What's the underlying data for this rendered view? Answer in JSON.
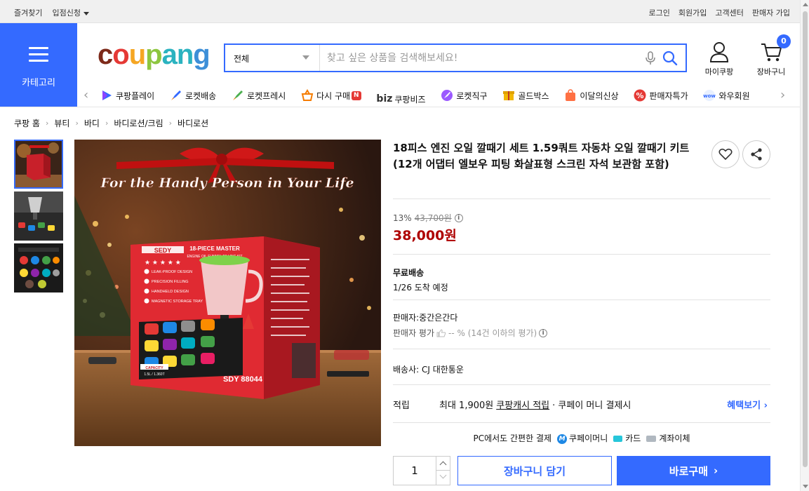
{
  "topbar": {
    "left": [
      "즐겨찾기",
      "입점신청"
    ],
    "right": [
      "로그인",
      "회원가입",
      "고객센터",
      "판매자 가입"
    ]
  },
  "category": {
    "label": "카테고리"
  },
  "logo": {
    "text": [
      "c",
      "o",
      "u",
      "p",
      "a",
      "n",
      "g"
    ]
  },
  "search": {
    "scope": "전체",
    "placeholder": "찾고 싶은 상품을 검색해보세요!"
  },
  "header": {
    "mypage": "마이쿠팡",
    "cart": "장바구니",
    "cart_count": "0"
  },
  "nav": {
    "items": [
      {
        "label": "쿠팡플레이",
        "icon": "play-icon",
        "color": "#346aff"
      },
      {
        "label": "로켓배송",
        "icon": "rocket-icon",
        "color": "#346aff"
      },
      {
        "label": "로켓프레시",
        "icon": "rocket-fresh-icon",
        "color": "#4caf50"
      },
      {
        "label": "다시 구매",
        "icon": "basket-icon",
        "color": "#f57c00",
        "badge": "N"
      },
      {
        "label": "쿠팡비즈",
        "icon": "biz-icon",
        "color": "#333333",
        "prefix": "biz"
      },
      {
        "label": "로켓직구",
        "icon": "rocket-direct-icon",
        "color": "#7e57c2"
      },
      {
        "label": "골드박스",
        "icon": "gold-box-icon",
        "color": "#f2b705"
      },
      {
        "label": "이달의신상",
        "icon": "new-bag-icon",
        "color": "#ff7043"
      },
      {
        "label": "판매자특가",
        "icon": "percent-icon",
        "color": "#e53935"
      },
      {
        "label": "와우회원",
        "icon": "wow-icon",
        "color": "#346aff"
      }
    ]
  },
  "breadcrumb": [
    "쿠팡 홈",
    "뷰티",
    "바디",
    "바디로션/크림",
    "바디로션"
  ],
  "product": {
    "title": "18피스 엔진 오일 깔때기 세트 1.59쿼트 자동차 오일 깔때기 키트 (12개 어댑터 엘보우 피팅 화살표형 스크린 자석 보관함 포함)",
    "discount": "13%",
    "original_price": "43,700원",
    "price": "38,000원",
    "shipping_title": "무료배송",
    "delivery": "1/26 도착 예정",
    "seller": "판매자:중간은간다",
    "seller_rating_label": "판매자 평가",
    "seller_rating_value": "-- % (14건 이하의 평가)",
    "carrier": "배송사: CJ 대한통운",
    "reward_label": "적립",
    "reward_text": "최대 1,900원",
    "reward_link": "쿠팡캐시 적립",
    "reward_tail": "· 쿠페이 머니 결제시",
    "reward_more": "혜택보기",
    "pay_intro": "PC에서도 간편한 결제",
    "pay_methods": [
      "쿠페이머니",
      "카드",
      "계좌이체"
    ],
    "quantity": "1",
    "add_to_cart": "장바구니 담기",
    "buy_now": "바로구매"
  },
  "image": {
    "banner_text": "For the Handy Person in Your Life",
    "box_brand": "SEDY",
    "box_title": "18-PIECE MASTER",
    "box_subtitle": "ENGINE OIL FUNNEL FILLING KIT",
    "box_features": [
      "LEAK-PROOF DESIGN",
      "PRECISION FILLING",
      "HANDHELD DESIGN",
      "MAGNETIC STORAGE TRAY"
    ],
    "box_capacity": "CAPACITY",
    "box_capacity_value": "1.5L / 1.360T",
    "box_model": "SDY 88044"
  },
  "colors": {
    "accent": "#346aff",
    "price": "#ae0000"
  }
}
